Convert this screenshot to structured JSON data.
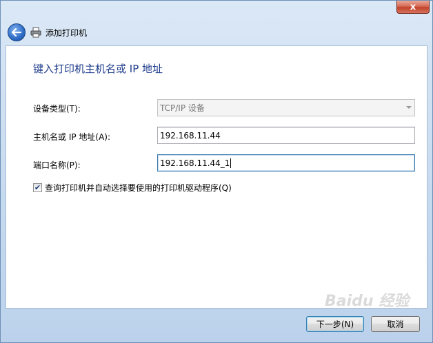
{
  "window": {
    "title": "添加打印机",
    "close_label": "x"
  },
  "page": {
    "heading": "键入打印机主机名或 IP 地址"
  },
  "form": {
    "device_type": {
      "label": "设备类型(T):",
      "value": "TCP/IP 设备"
    },
    "hostname": {
      "label": "主机名或 IP 地址(A):",
      "value": "192.168.11.44"
    },
    "port_name": {
      "label": "端口名称(P):",
      "value": "192.168.11.44_1"
    },
    "auto_driver": {
      "label": "查询打印机并自动选择要使用的打印机驱动程序(Q)",
      "checked": true
    }
  },
  "buttons": {
    "next": "下一步(N)",
    "cancel": "取消"
  },
  "watermark": "Baidu 经验"
}
